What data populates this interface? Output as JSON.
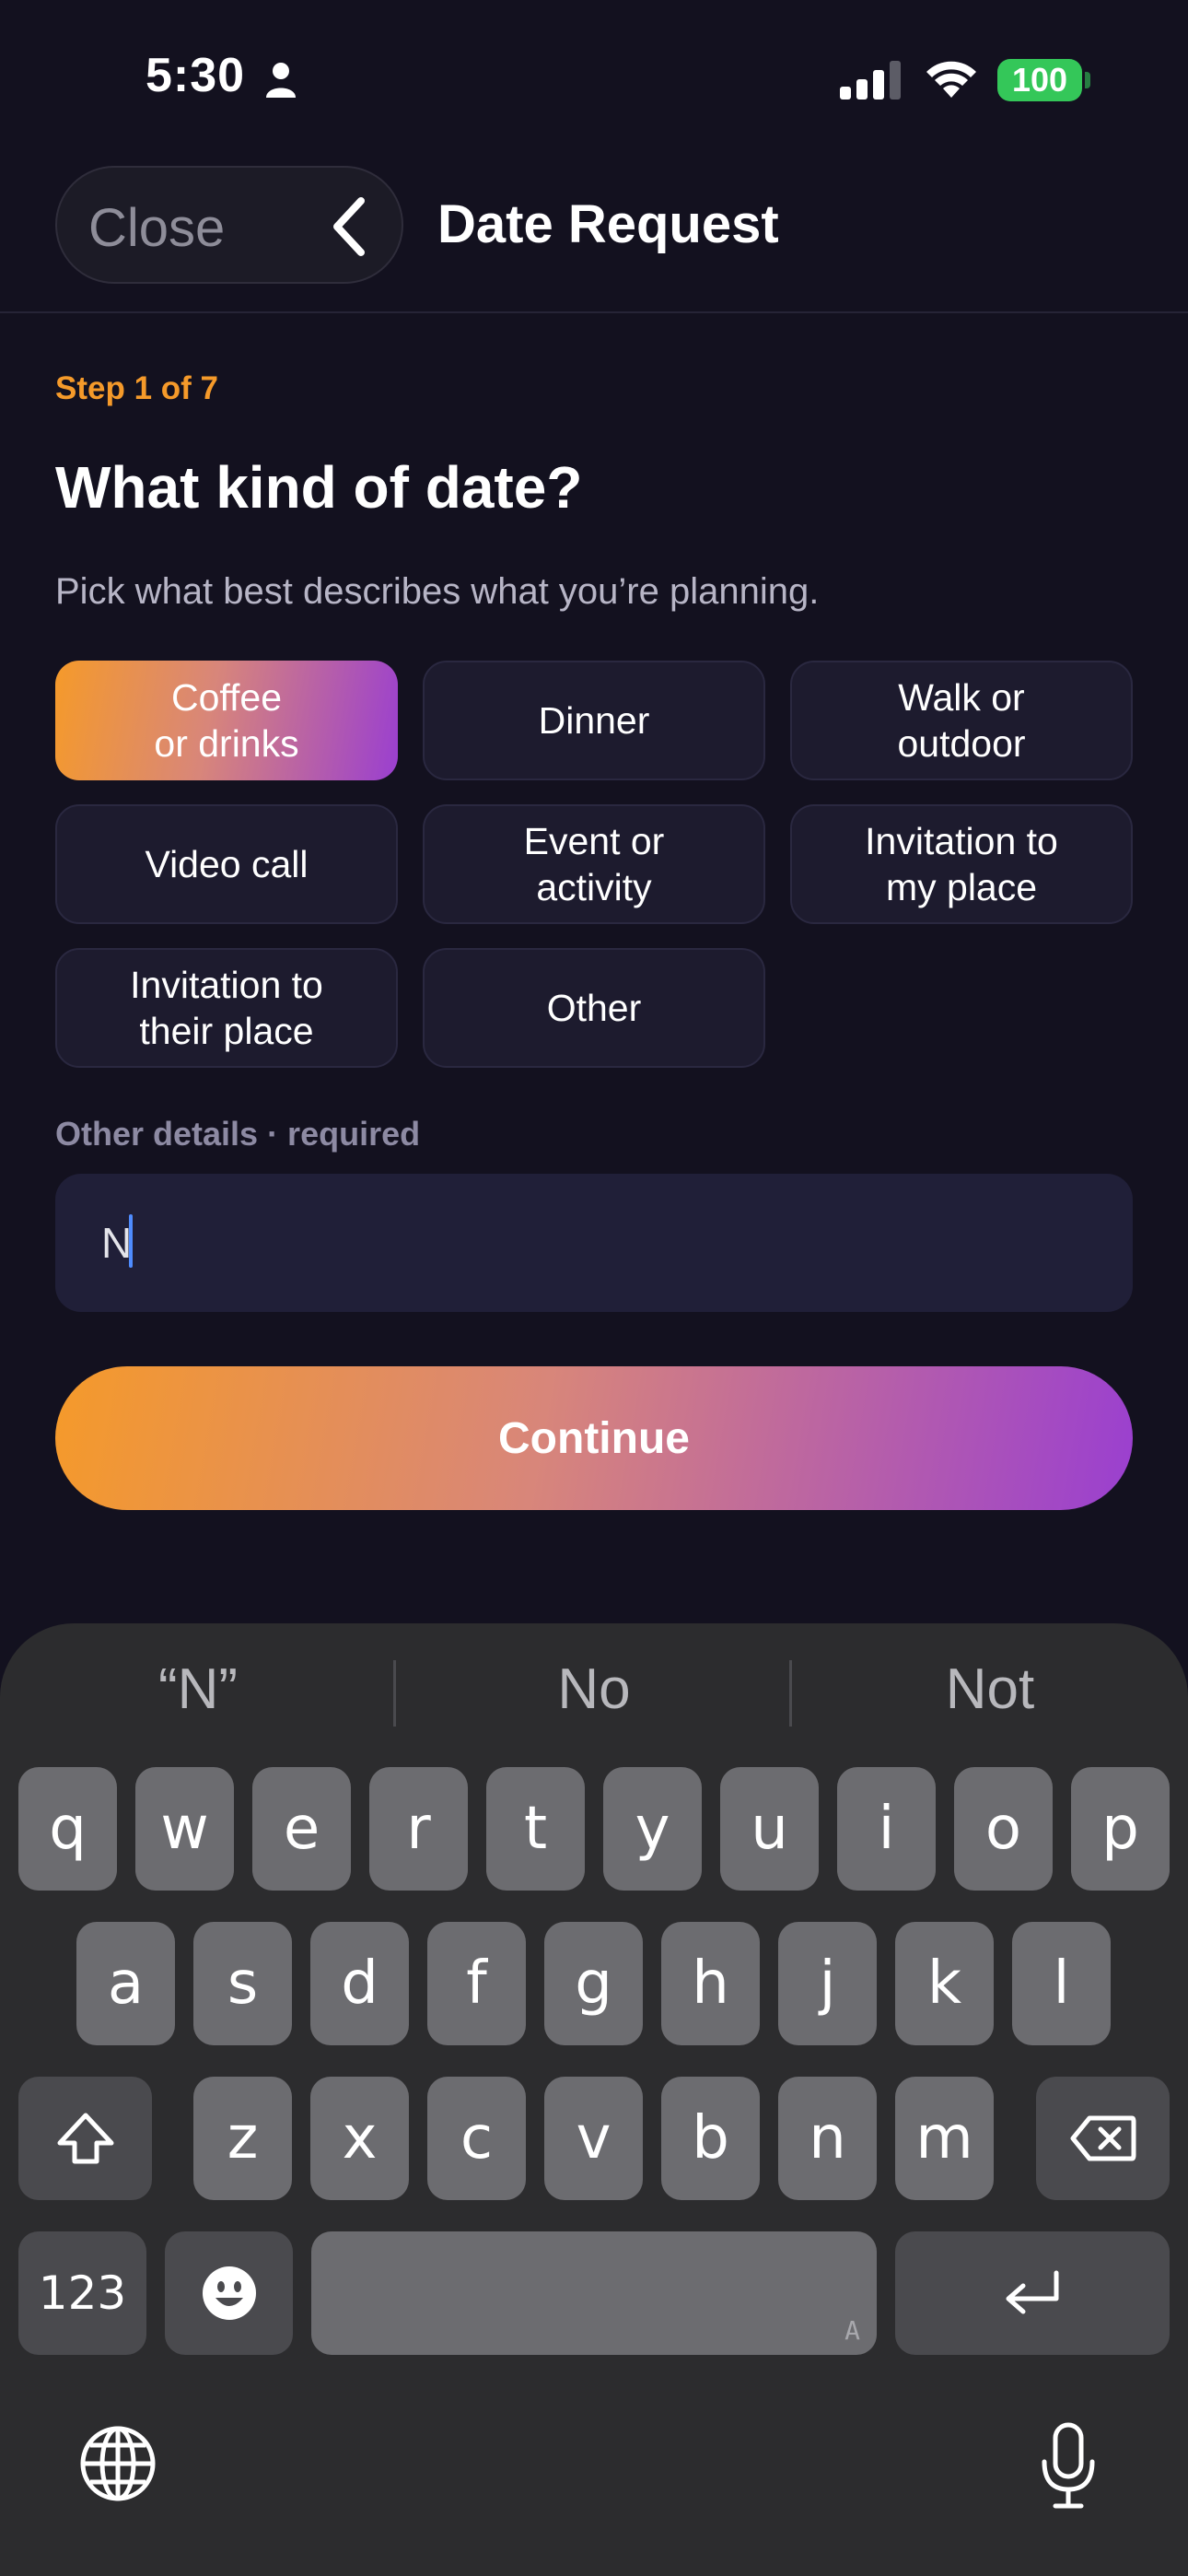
{
  "status_bar": {
    "time": "5:30",
    "battery": "100"
  },
  "header": {
    "close_label": "Close",
    "title": "Date Request"
  },
  "step_label": "Step 1 of 7",
  "question": "What kind of date?",
  "subtitle": "Pick what best describes what you’re planning.",
  "options": [
    {
      "label": "Coffee\nor drinks",
      "selected": true
    },
    {
      "label": "Dinner",
      "selected": false
    },
    {
      "label": "Walk or\noutdoor",
      "selected": false
    },
    {
      "label": "Video call",
      "selected": false
    },
    {
      "label": "Event or\nactivity",
      "selected": false
    },
    {
      "label": "Invitation to\nmy place",
      "selected": false
    },
    {
      "label": "Invitation to\ntheir place",
      "selected": false
    },
    {
      "label": "Other",
      "selected": false
    }
  ],
  "other_details": {
    "label": "Other details · required",
    "value": "N"
  },
  "continue_label": "Continue",
  "keyboard": {
    "suggestions": [
      "“N”",
      "No",
      "Not"
    ],
    "row1": [
      "q",
      "w",
      "e",
      "r",
      "t",
      "y",
      "u",
      "i",
      "o",
      "p"
    ],
    "row2": [
      "a",
      "s",
      "d",
      "f",
      "g",
      "h",
      "j",
      "k",
      "l"
    ],
    "row3": [
      "z",
      "x",
      "c",
      "v",
      "b",
      "n",
      "m"
    ],
    "numbers_key": "123",
    "space_hint": "A"
  },
  "colors": {
    "accent_orange": "#f59a2a",
    "accent_purple": "#9a3fd0",
    "battery_green": "#34c759"
  }
}
